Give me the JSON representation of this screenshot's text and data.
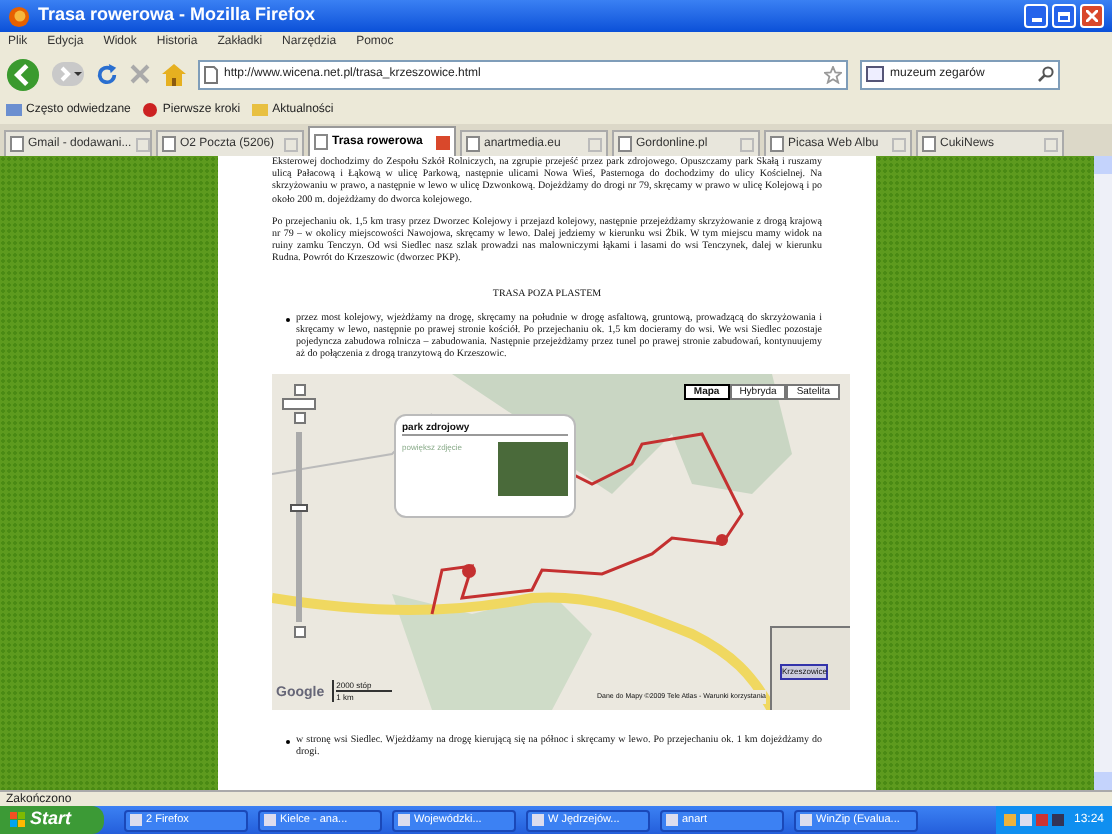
{
  "window": {
    "title": "Trasa rowerowa - Mozilla Firefox"
  },
  "menu": [
    "Plik",
    "Edycja",
    "Widok",
    "Historia",
    "Zakładki",
    "Narzędzia",
    "Pomoc"
  ],
  "address_bar": {
    "value": "http://www.wicena.net.pl/trasa_krzeszowice.html"
  },
  "search": {
    "value": "muzeum zegarów"
  },
  "bookmarks": [
    "Często odwiedzane",
    "Pierwsze kroki",
    "Aktualności"
  ],
  "tabs": [
    {
      "label": "Gmail - dodawani...",
      "selected": false
    },
    {
      "label": "O2 Poczta (5206)",
      "selected": false
    },
    {
      "label": "Trasa rowerowa",
      "selected": true
    },
    {
      "label": "anartmedia.eu",
      "selected": false
    },
    {
      "label": "Gordonline.pl",
      "selected": false
    },
    {
      "label": "Picasa Web Albu",
      "selected": false
    },
    {
      "label": "CukiNews",
      "selected": false
    }
  ],
  "article": {
    "paragraphs": [
      "Eksterowej dochodzimy do Zespołu Szkół Rolniczych, na zgrupie przejeść przez park zdrojowego. Opuszczamy park Skałą i ruszamy ulicą Pałacową i Łąkową w ulicę Parkową, następnie ulicami Nowa Wieś, Pasternoga do dochodzimy do ulicy Kościelnej. Na skrzyżowaniu w prawo, a następnie w lewo w ulicę Dzwonkową. Dojeżdżamy do drogi nr 79, skręcamy w prawo w ulicę Kolejową i po około 200 m. dojeżdżamy do dworca kolejowego.",
      "Po przejechaniu ok. 1,5 km trasy przez Dworzec Kolejowy i przejazd kolejowy, następnie przejeżdżamy skrzyżowanie z drogą krajową nr 79 – w okolicy miejscowości Nawojowa, skręcamy w lewo. Dalej jedziemy w kierunku wsi Żbik. W tym miejscu mamy widok na ruiny zamku Tenczyn. Od wsi Siedlec nasz szlak prowadzi nas malowniczymi łąkami i lasami do wsi Tenczynek, dalej w kierunku Rudna. Powrót do Krzeszowic (dworzec PKP)."
    ],
    "heading": "TRASA POZA PLASTEM",
    "bullets": [
      "przez most kolejowy, wjeżdżamy na drogę, skręcamy na południe w drogę asfaltową, gruntową, prowadzącą do skrzyżowania i skręcamy w lewo, następnie po prawej stronie kościół. Po przejechaniu ok. 1,5 km docieramy do wsi. We wsi Siedlec pozostaje pojedyncza zabudowa rolnicza – zabudowania. Następnie przejeżdżamy przez tunel po prawej stronie zabudowań, kontynuujemy aż do połączenia z drogą tranzytową do Krzeszowic.",
      "w stronę wsi Siedlec. Wjeżdżamy na drogę kierującą się na północ i skręcamy w lewo. Po przejechaniu ok. 1 km dojeżdżamy do drogi."
    ]
  },
  "map": {
    "zoom": {
      "level": 0.6
    },
    "logo": "Google",
    "map_types": [
      {
        "label": "Mapa",
        "selected": true
      },
      {
        "label": "Hybryda",
        "selected": false
      },
      {
        "label": "Satelita",
        "selected": false
      }
    ],
    "popup_title": "park zdrojowy",
    "popup_link": "powiększ zdjęcie",
    "scale": [
      "2000 stóp",
      "1 km"
    ],
    "copyright": "Dane do Mapy ©2009 Tele Atlas - Warunki korzystania",
    "minimap_label": "Krzeszowice"
  },
  "status_bar": "Zakończono",
  "taskbar": {
    "start": "Start",
    "buttons": [
      "2 Firefox",
      "Kielce - ana...",
      "Wojewódzki...",
      "W Jędrzejów...",
      "anart",
      "WinZip (Evalua..."
    ],
    "clock": "13:24"
  }
}
